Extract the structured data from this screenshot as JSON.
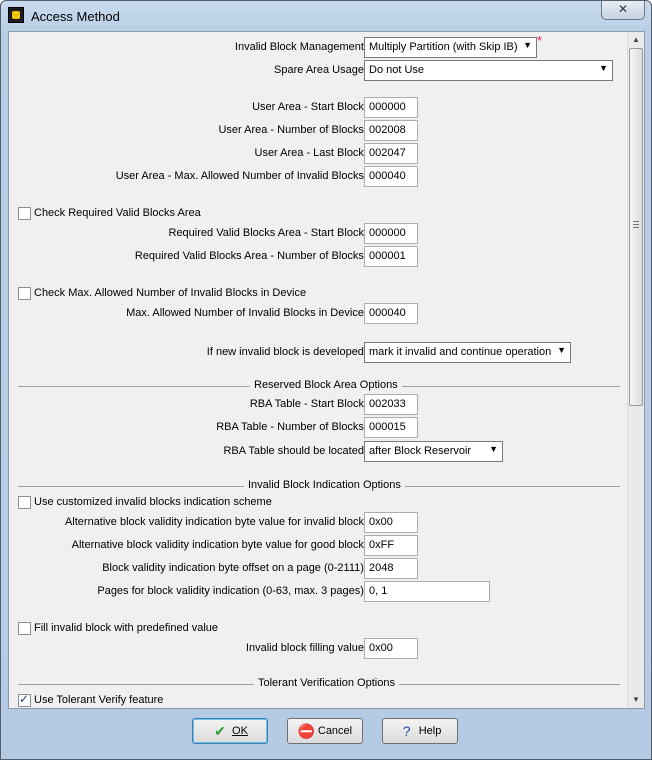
{
  "window": {
    "title": "Access Method",
    "close": "✕"
  },
  "form": {
    "ibm_label": "Invalid Block Management:",
    "ibm_value": "Multiply Partition (with Skip IB)",
    "ibm_star": "*",
    "spare_label": "Spare Area Usage:",
    "spare_value": "Do not Use",
    "ua_start_label": "User Area - Start Block:",
    "ua_start_value": "000000",
    "ua_num_label": "User Area - Number of Blocks:",
    "ua_num_value": "002008",
    "ua_last_label": "User Area - Last Block:",
    "ua_last_value": "002047",
    "ua_max_label": "User Area - Max. Allowed Number of Invalid Blocks:",
    "ua_max_value": "000040",
    "chk_required_label": "Check Required Valid Blocks Area",
    "rv_start_label": "Required Valid Blocks Area - Start Block:",
    "rv_start_value": "000000",
    "rv_num_label": "Required Valid Blocks Area - Number of Blocks:",
    "rv_num_value": "000001",
    "chk_max_label": "Check Max. Allowed Number of Invalid Blocks in Device",
    "max_dev_label": "Max. Allowed Number of Invalid Blocks in Device:",
    "max_dev_value": "000040",
    "new_invalid_label": "If new invalid block is developed:",
    "new_invalid_value": "mark it invalid and continue operation",
    "rba_section": "Reserved Block Area Options",
    "rba_start_label": "RBA Table - Start Block:",
    "rba_start_value": "002033",
    "rba_num_label": "RBA Table - Number of Blocks:",
    "rba_num_value": "000015",
    "rba_loc_label": "RBA Table should be located:",
    "rba_loc_value": "after Block Reservoir",
    "ibi_section": "Invalid Block Indication Options",
    "chk_custom_label": "Use customized invalid blocks indication scheme",
    "alt_invalid_label": "Alternative block validity indication byte value for invalid block:",
    "alt_invalid_value": "0x00",
    "alt_good_label": "Alternative block validity indication byte value for good block:",
    "alt_good_value": "0xFF",
    "offset_label": "Block validity indication byte offset on a page (0-2111):",
    "offset_value": "2048",
    "pages_label": "Pages for block validity indication (0-63, max. 3 pages):",
    "pages_value": "0, 1",
    "chk_fill_label": "Fill invalid block with predefined value",
    "fill_label": "Invalid block filling value:",
    "fill_value": "0x00",
    "tv_section": "Tolerant Verification Options",
    "chk_tolerant_label": "Use Tolerant Verify feature"
  },
  "buttons": {
    "ok": "OK",
    "cancel": "Cancel",
    "help": "Help"
  },
  "icons": {
    "ok": "check-icon",
    "cancel": "no-entry-icon",
    "help": "question-icon"
  }
}
